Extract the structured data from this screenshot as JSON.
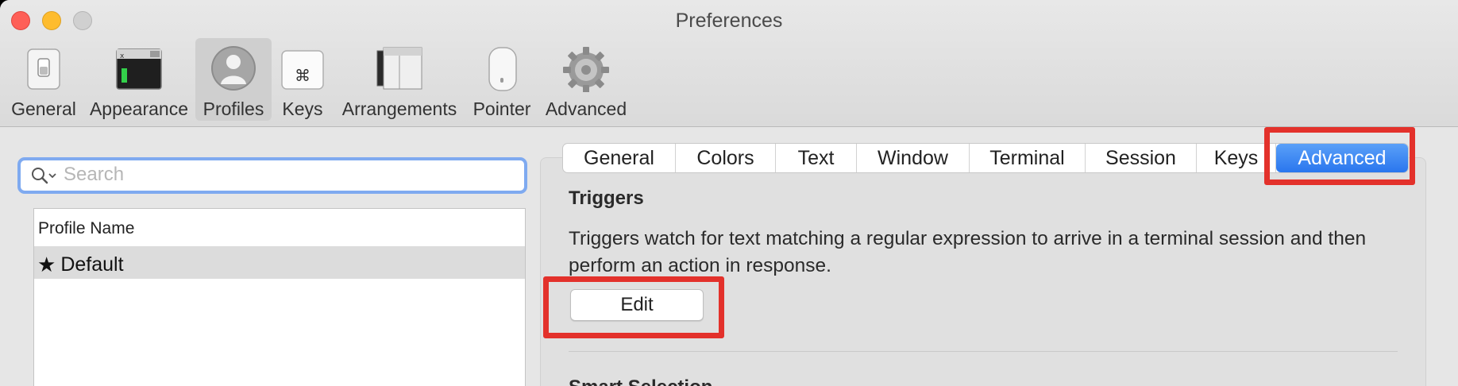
{
  "window": {
    "title": "Preferences",
    "ghost_title": "Profiles"
  },
  "toolbar": {
    "items": [
      {
        "label": "General",
        "icon": "general-switch-icon"
      },
      {
        "label": "Appearance",
        "icon": "appearance-terminal-icon"
      },
      {
        "label": "Profiles",
        "icon": "profile-person-icon",
        "selected": true
      },
      {
        "label": "Keys",
        "icon": "command-key-icon"
      },
      {
        "label": "Arrangements",
        "icon": "arrangements-windows-icon"
      },
      {
        "label": "Pointer",
        "icon": "mouse-icon"
      },
      {
        "label": "Advanced",
        "icon": "gear-icon"
      }
    ]
  },
  "search": {
    "placeholder": "Search"
  },
  "profiles": {
    "header": "Profile Name",
    "rows": [
      {
        "name": "Default",
        "default_marker": "★"
      }
    ]
  },
  "tabs": {
    "items": [
      "General",
      "Colors",
      "Text",
      "Window",
      "Terminal",
      "Session",
      "Keys",
      "Advanced"
    ],
    "active": "Advanced"
  },
  "triggers": {
    "title": "Triggers",
    "description": "Triggers watch for text matching a regular expression to arrive in a terminal session and then perform an action in response.",
    "edit_label": "Edit"
  },
  "next_section": {
    "title": "Smart Selection"
  },
  "colors": {
    "accent": "#2a76ee",
    "highlight": "#e3312b"
  }
}
